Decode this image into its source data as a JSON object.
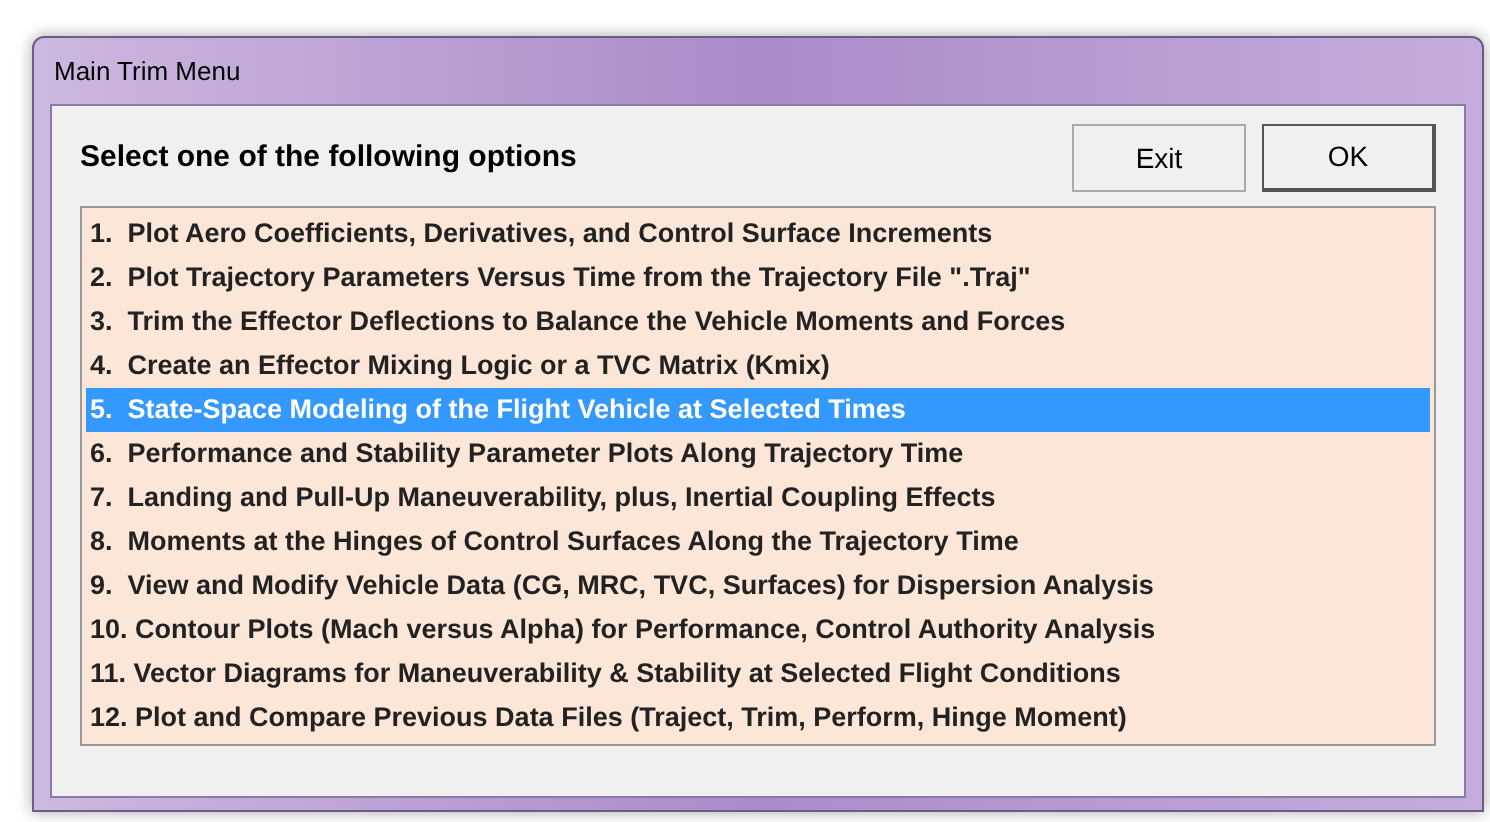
{
  "window": {
    "title": "Main Trim Menu"
  },
  "heading": "Select one of the following options",
  "buttons": [
    {
      "label": "Exit",
      "default": false
    },
    {
      "label": "OK",
      "default": true
    }
  ],
  "options": [
    {
      "label": "1.  Plot Aero Coefficients, Derivatives, and Control Surface Increments",
      "selected": false
    },
    {
      "label": "2.  Plot Trajectory Parameters Versus Time from the Trajectory File \".Traj\"",
      "selected": false
    },
    {
      "label": "3.  Trim the Effector Deflections to Balance the Vehicle Moments and Forces",
      "selected": false
    },
    {
      "label": "4.  Create an Effector Mixing Logic or a TVC Matrix (Kmix)",
      "selected": false
    },
    {
      "label": "5.  State-Space Modeling of the Flight Vehicle at Selected Times",
      "selected": true
    },
    {
      "label": "6.  Performance and Stability Parameter Plots Along Trajectory Time",
      "selected": false
    },
    {
      "label": "7.  Landing and Pull-Up Maneuverability, plus, Inertial Coupling Effects",
      "selected": false
    },
    {
      "label": "8.  Moments at the Hinges of Control Surfaces Along the Trajectory Time",
      "selected": false
    },
    {
      "label": "9.  View and Modify Vehicle Data (CG, MRC, TVC, Surfaces) for Dispersion Analysis",
      "selected": false
    },
    {
      "label": "10. Contour Plots (Mach versus Alpha) for Performance, Control Authority Analysis",
      "selected": false
    },
    {
      "label": "11. Vector Diagrams for Maneuverability & Stability at Selected Flight Conditions",
      "selected": false
    },
    {
      "label": "12. Plot and Compare Previous Data Files (Traject, Trim, Perform, Hinge Moment)",
      "selected": false
    }
  ]
}
